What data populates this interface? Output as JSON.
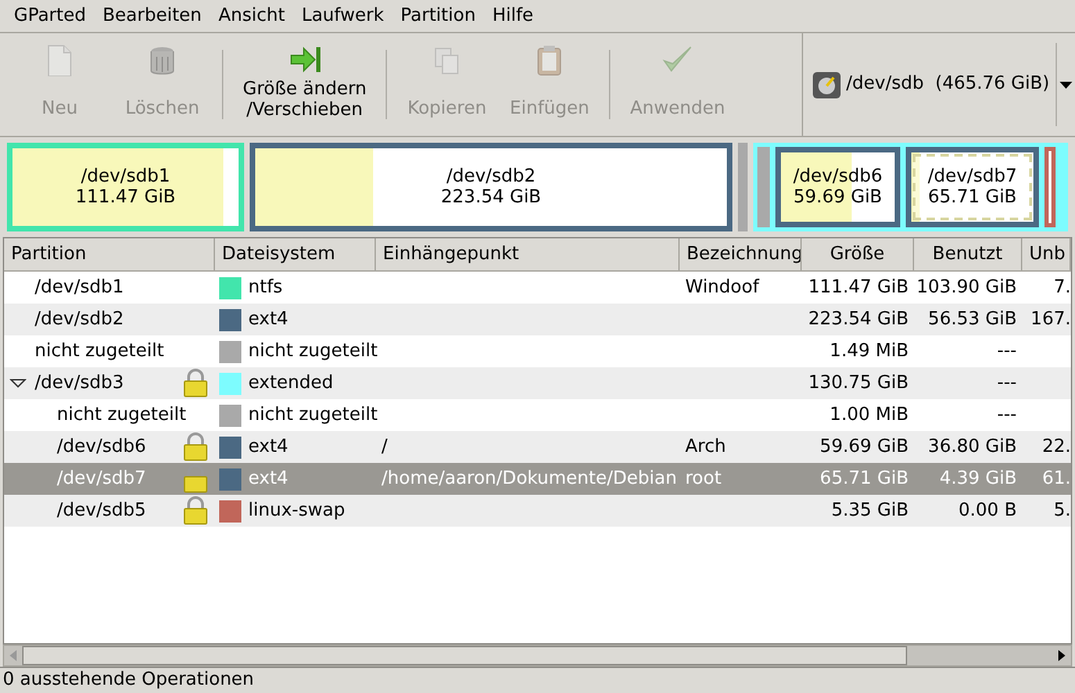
{
  "menu": [
    "GParted",
    "Bearbeiten",
    "Ansicht",
    "Laufwerk",
    "Partition",
    "Hilfe"
  ],
  "toolbar": [
    [
      {
        "label": "Neu",
        "disabled": true
      },
      {
        "label": "Löschen",
        "disabled": true
      }
    ],
    [
      {
        "label": "Größe ändern\n/Verschieben",
        "disabled": false
      }
    ],
    [
      {
        "label": "Kopieren",
        "disabled": true
      },
      {
        "label": "Einfügen",
        "disabled": true
      }
    ],
    [
      {
        "label": "Anwenden",
        "disabled": true
      }
    ]
  ],
  "device": {
    "path": "/dev/sdb",
    "size": "(465.76 GiB)"
  },
  "disk_map": [
    {
      "kind": "partition",
      "label": "/dev/sdb1",
      "size": "111.47 GiB",
      "color": "#42e5ac",
      "level": 0.93,
      "selected": false
    },
    {
      "kind": "partition",
      "label": "/dev/sdb2",
      "size": "223.54 GiB",
      "color": "#4b6983",
      "level": 0.25,
      "selected": false
    },
    {
      "kind": "unallocated",
      "color": "#a9a9a9"
    },
    {
      "kind": "extended",
      "color": "#7dfcfe",
      "children": [
        {
          "kind": "unallocated",
          "color": "#a9a9a9"
        },
        {
          "kind": "partition",
          "label": "/dev/sdb6",
          "size": "59.69 GiB",
          "color": "#4b6983",
          "level": 0.62,
          "selected": false
        },
        {
          "kind": "partition",
          "label": "/dev/sdb7",
          "size": "65.71 GiB",
          "color": "#4b6983",
          "level": 0.07,
          "selected": true
        },
        {
          "kind": "partition",
          "color": "#c1665a",
          "selected": false
        }
      ]
    }
  ],
  "table": {
    "columns": [
      "Partition",
      "Dateisystem",
      "Einhängepunkt",
      "Bezeichnung",
      "Größe",
      "Benutzt",
      "Unb"
    ],
    "rows": [
      {
        "partition": "/dev/sdb1",
        "locked": false,
        "filesystem": "ntfs",
        "color": "#42e5ac",
        "label": "Windoof",
        "size": "111.47 GiB",
        "used": "103.90 GiB",
        "unused": "7.",
        "selected": false
      },
      {
        "partition": "/dev/sdb2",
        "locked": false,
        "filesystem": "ext4",
        "color": "#4b6983",
        "size": "223.54 GiB",
        "used": "56.53 GiB",
        "unused": "167.",
        "selected": false
      },
      {
        "partition": "nicht zugeteilt",
        "locked": false,
        "filesystem": "nicht zugeteilt",
        "color": "#a9a9a9",
        "size": "1.49 MiB",
        "used": "---",
        "selected": false
      },
      {
        "partition": "/dev/sdb3",
        "locked": true,
        "filesystem": "extended",
        "color": "#7dfcfe",
        "size": "130.75 GiB",
        "used": "---",
        "selected": false,
        "expanded": true,
        "children": [
          {
            "partition": "nicht zugeteilt",
            "locked": false,
            "filesystem": "nicht zugeteilt",
            "color": "#a9a9a9",
            "size": "1.00 MiB",
            "used": "---",
            "selected": false
          },
          {
            "partition": "/dev/sdb6",
            "locked": true,
            "filesystem": "ext4",
            "color": "#4b6983",
            "mount": "/",
            "label": "Arch",
            "size": "59.69 GiB",
            "used": "36.80 GiB",
            "unused": "22.",
            "selected": false
          },
          {
            "partition": "/dev/sdb7",
            "locked": true,
            "filesystem": "ext4",
            "color": "#4b6983",
            "mount": "/home/aaron/Dokumente/Debian",
            "label": "root",
            "size": "65.71 GiB",
            "used": "4.39 GiB",
            "unused": "61.",
            "selected": true
          },
          {
            "partition": "/dev/sdb5",
            "locked": true,
            "filesystem": "linux-swap",
            "color": "#c1665a",
            "size": "5.35 GiB",
            "used": "0.00 B",
            "unused": "5.",
            "selected": false
          }
        ]
      }
    ]
  },
  "status_bar": "0 ausstehende Operationen"
}
